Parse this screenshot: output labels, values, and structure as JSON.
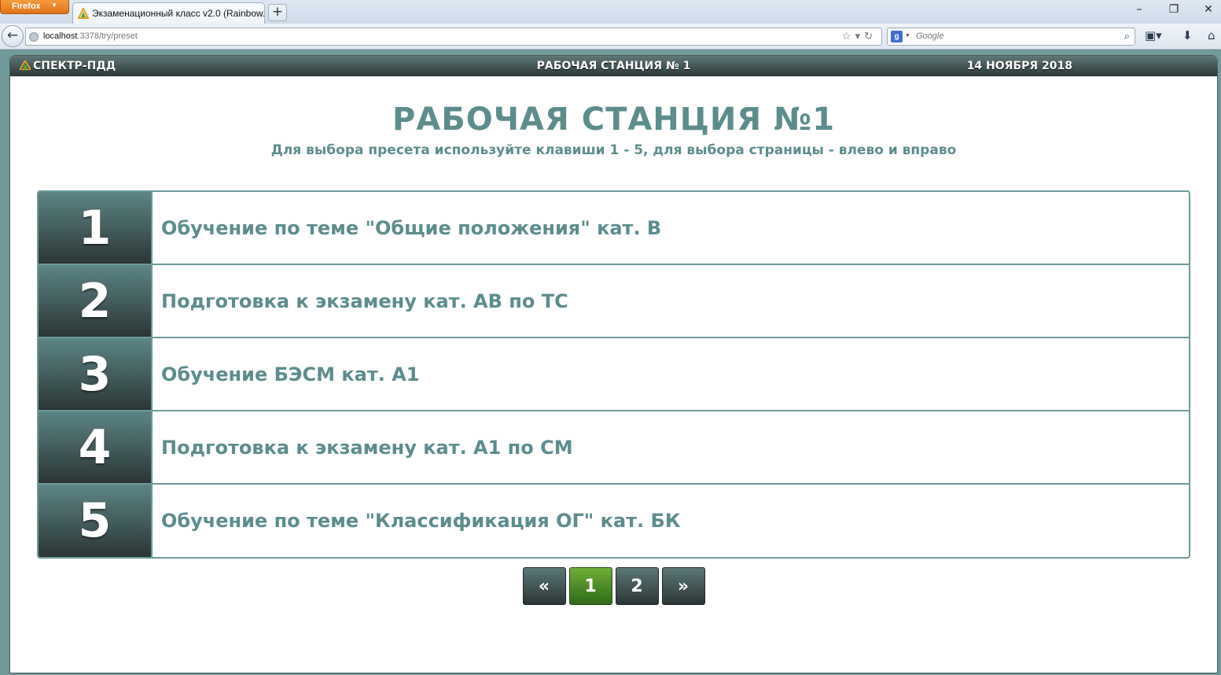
{
  "browser": {
    "menu_label": "Firefox",
    "tab_title": "Экзаменационный класс v2.0 (Rainbow...",
    "new_tab_label": "+",
    "url_host": "localhost",
    "url_path": ":3378/try/preset",
    "search_placeholder": "Google"
  },
  "header": {
    "brand": "СПЕКТР-ПДД",
    "station": "РАБОЧАЯ СТАНЦИЯ № 1",
    "date": "14 НОЯБРЯ 2018"
  },
  "main": {
    "title": "РАБОЧАЯ СТАНЦИЯ №1",
    "hint": "Для выбора пресета используйте клавиши 1 - 5, для выбора страницы - влево и вправо"
  },
  "presets": [
    {
      "num": "1",
      "label": "Обучение по теме \"Общие положения\" кат. В"
    },
    {
      "num": "2",
      "label": "Подготовка к экзамену кат. АВ по ТС"
    },
    {
      "num": "3",
      "label": "Обучение БЭСМ кат. А1"
    },
    {
      "num": "4",
      "label": "Подготовка к экзамену кат. А1 по СМ"
    },
    {
      "num": "5",
      "label": "Обучение по теме \"Классификация ОГ\" кат. БК"
    }
  ],
  "pager": {
    "prev": "«",
    "pages": [
      "1",
      "2"
    ],
    "next": "»",
    "active_page": "1"
  },
  "colors": {
    "accent": "#5c8d8d",
    "active_page": "#4f8f2a",
    "header_dark": "#2c3838"
  }
}
